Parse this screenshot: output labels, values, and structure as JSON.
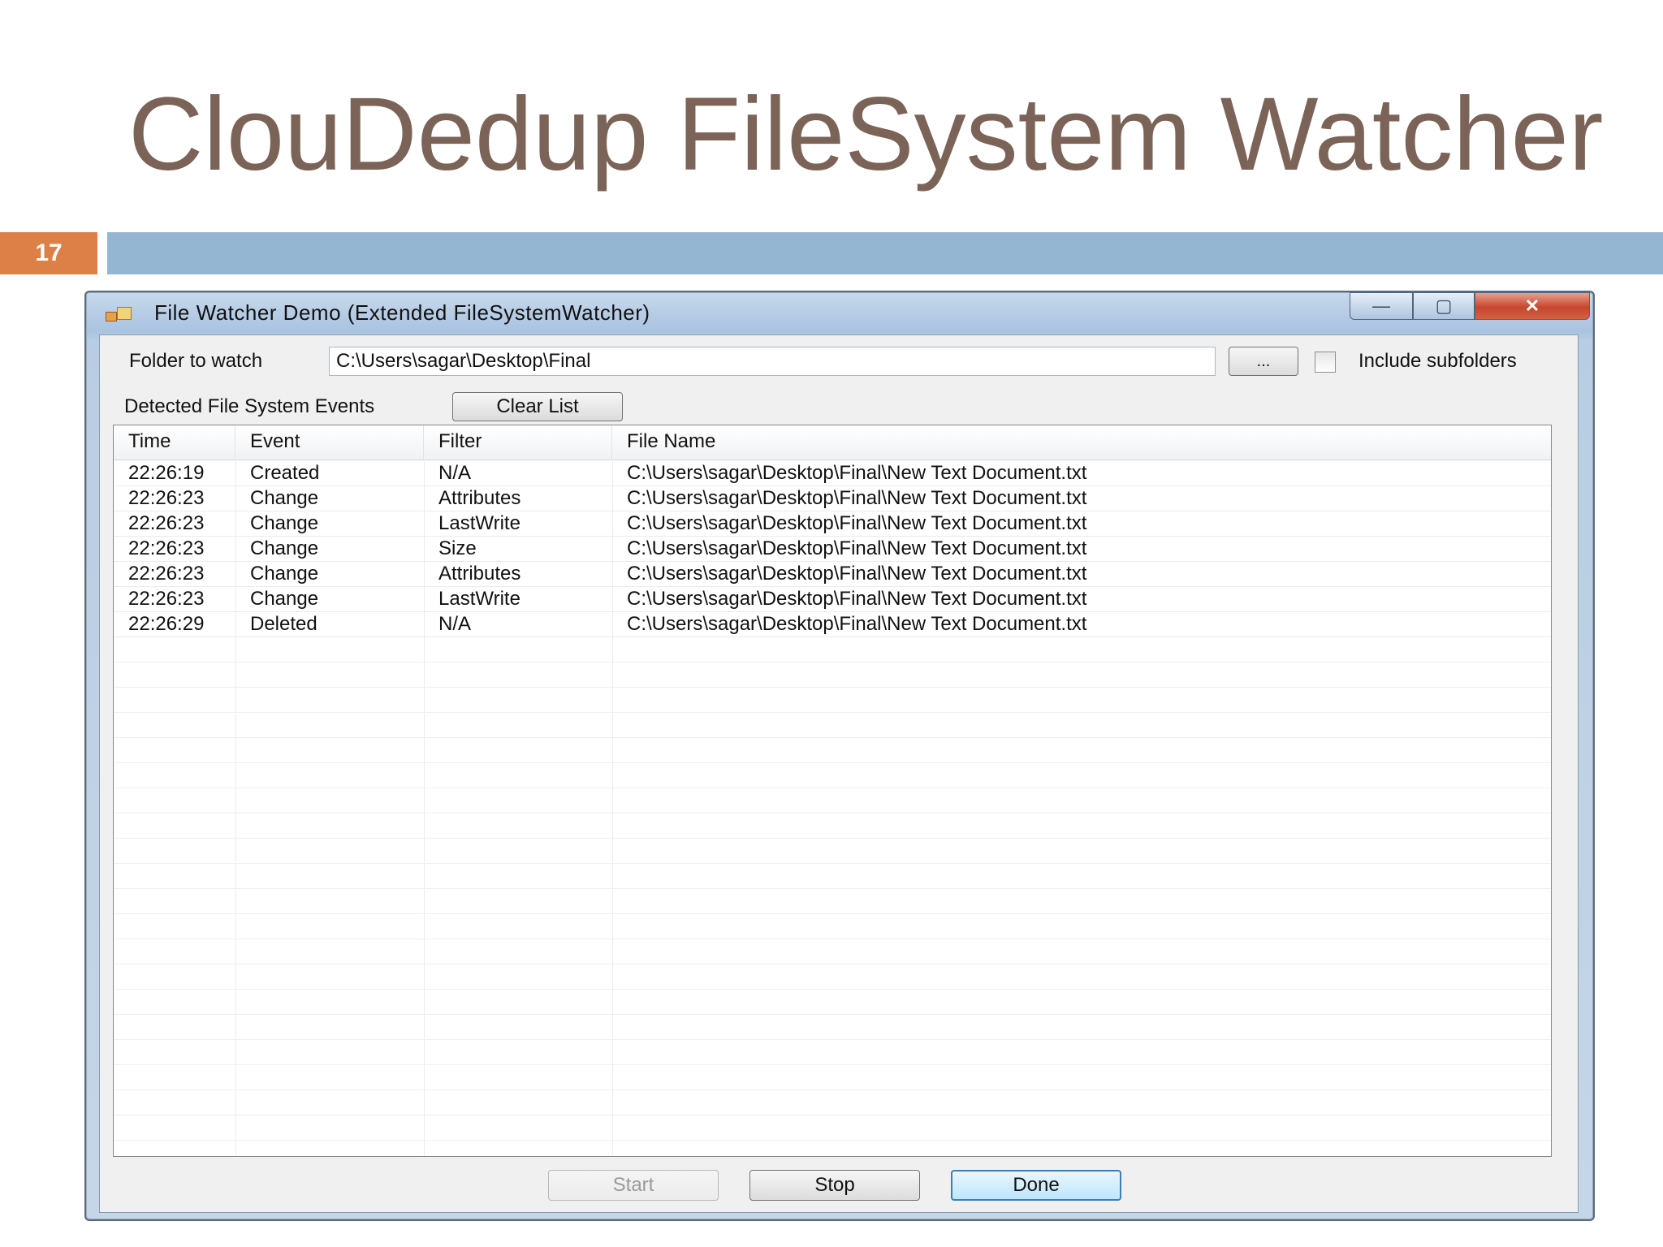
{
  "slide": {
    "title": "ClouDedup FileSystem Watcher",
    "number": "17"
  },
  "window": {
    "title": "File Watcher Demo (Extended FileSystemWatcher)",
    "controls": {
      "minimize": "—",
      "maximize": "▢",
      "close": "✕"
    }
  },
  "folder": {
    "label": "Folder to watch",
    "value": "C:\\Users\\sagar\\Desktop\\Final",
    "browse_label": "...",
    "include_subfolders_label": "Include subfolders",
    "include_subfolders_checked": false
  },
  "events": {
    "label": "Detected File System Events",
    "clear_label": "Clear List",
    "columns": [
      "Time",
      "Event",
      "Filter",
      "File Name"
    ],
    "rows": [
      [
        "22:26:19",
        "Created",
        "N/A",
        "C:\\Users\\sagar\\Desktop\\Final\\New Text Document.txt"
      ],
      [
        "22:26:23",
        "Change",
        "Attributes",
        "C:\\Users\\sagar\\Desktop\\Final\\New Text Document.txt"
      ],
      [
        "22:26:23",
        "Change",
        "LastWrite",
        "C:\\Users\\sagar\\Desktop\\Final\\New Text Document.txt"
      ],
      [
        "22:26:23",
        "Change",
        "Size",
        "C:\\Users\\sagar\\Desktop\\Final\\New Text Document.txt"
      ],
      [
        "22:26:23",
        "Change",
        "Attributes",
        "C:\\Users\\sagar\\Desktop\\Final\\New Text Document.txt"
      ],
      [
        "22:26:23",
        "Change",
        "LastWrite",
        "C:\\Users\\sagar\\Desktop\\Final\\New Text Document.txt"
      ],
      [
        "22:26:29",
        "Deleted",
        "N/A",
        "C:\\Users\\sagar\\Desktop\\Final\\New Text Document.txt"
      ]
    ]
  },
  "buttons": {
    "start": "Start",
    "stop": "Stop",
    "done": "Done"
  },
  "colors": {
    "title_text": "#7b6357",
    "slide_number_bg": "#dd8047",
    "slide_bar": "#94b6d2"
  }
}
